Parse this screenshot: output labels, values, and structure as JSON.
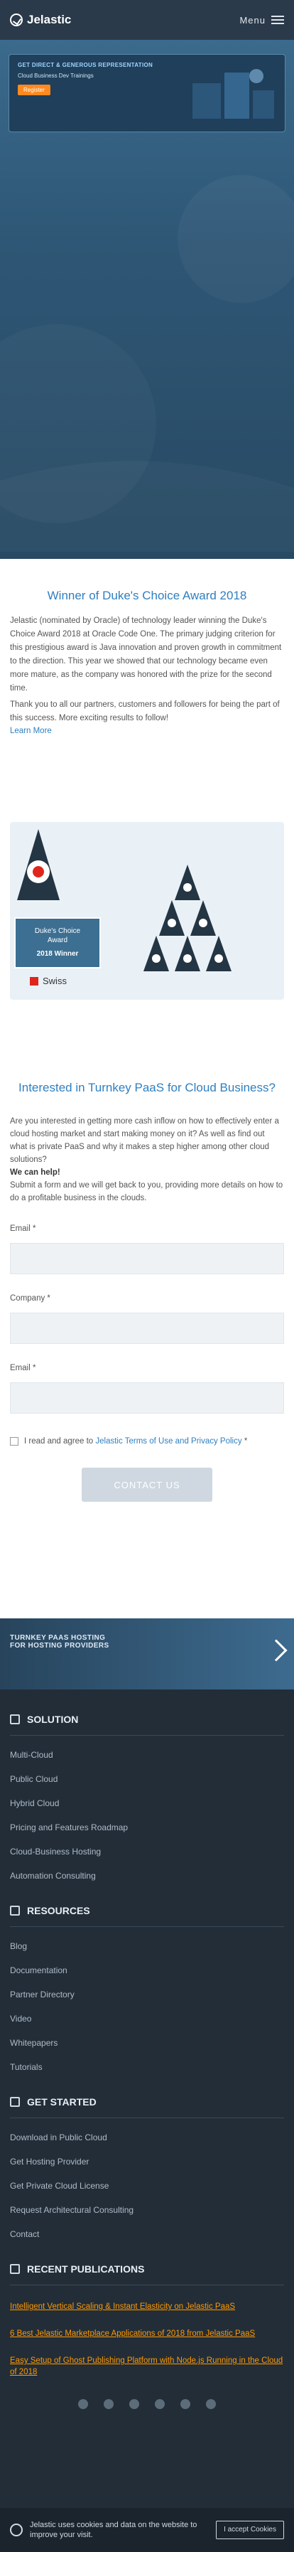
{
  "header": {
    "brand": "Jelastic",
    "menu_label": "Menu"
  },
  "promo": {
    "title": "GET DIRECT & GENEROUS REPRESENTATION",
    "subtitle": "Cloud Business Dev Trainings",
    "button": "Register"
  },
  "award": {
    "title": "Winner of Duke's Choice Award 2018",
    "paragraph1": "Jelastic (nominated by Oracle) of technology leader winning the Duke's Choice Award 2018 at Oracle Code One. The primary judging criterion for this prestigious award is Java innovation and proven growth in commitment to the direction. This year we showed that our technology became even more mature, as the company was honored with the prize for the second time.",
    "paragraph2": "Thank you to all our partners, customers and followers for being the part of this success. More exciting results to follow!",
    "learn_more": "Learn More",
    "badge_line1": "Duke's Choice",
    "badge_line2": "Award",
    "badge_line3": "2018 Winner",
    "swiss": "Swiss"
  },
  "lead": {
    "title": "Interested in Turnkey PaaS for Cloud Business?",
    "paragraph": "Are you interested in getting more cash inflow on how to effectively enter a cloud hosting market and start making money on it? As well as find out what is private PaaS and why it makes a step higher among other cloud solutions?",
    "can_help": "We can help!",
    "paragraph2": "Submit a form and we will get back to you, providing more details on how to do a profitable business in the clouds.",
    "email_label": "Email *",
    "company_label": "Company *",
    "phone_label": "Email *",
    "agree_prefix": "I read and agree to ",
    "agree_link": "Jelastic Terms of Use and Privacy Policy",
    "agree_suffix": " *",
    "submit": "CONTACT US"
  },
  "footer": {
    "banner_line1": "TURNKEY PAAS HOSTING",
    "banner_line2": "FOR HOSTING PROVIDERS",
    "solution": {
      "title": "SOLUTION",
      "items": [
        "Multi-Cloud",
        "Public Cloud",
        "Hybrid Cloud",
        "Pricing and Features Roadmap",
        "Cloud-Business Hosting",
        "Automation Consulting"
      ]
    },
    "resources": {
      "title": "RESOURCES",
      "items": [
        "Blog",
        "Documentation",
        "Partner Directory",
        "Video",
        "Whitepapers",
        "Tutorials"
      ]
    },
    "get_started": {
      "title": "GET STARTED",
      "items": [
        "Download in Public Cloud",
        "Get Hosting Provider",
        "Get Private Cloud License",
        "Request Architectural Consulting",
        "Contact"
      ]
    },
    "publications": {
      "title": "RECENT PUBLICATIONS",
      "items": [
        "Intelligent Vertical Scaling & Instant Elasticity on Jelastic PaaS",
        "6 Best Jelastic Marketplace Applications of 2018 from Jelastic PaaS",
        "Easy Setup of Ghost Publishing Platform with Node.js Running in the Cloud of 2018"
      ]
    },
    "cookie_text": "Jelastic uses cookies and data on the website to improve your visit.",
    "cookie_button": "I accept Cookies"
  }
}
